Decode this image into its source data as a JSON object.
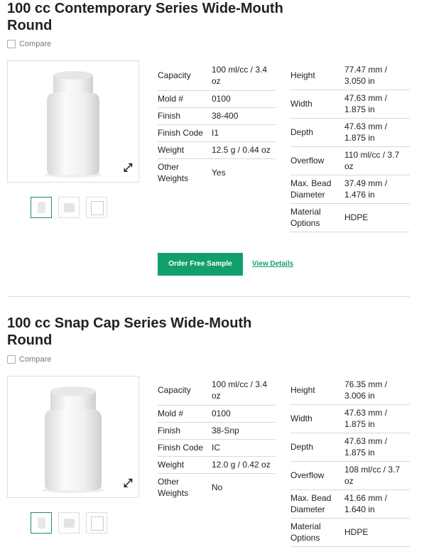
{
  "products": [
    {
      "title": "100 cc Contemporary Series Wide-Mouth Round",
      "compare_label": "Compare",
      "expand_icon": "expand-arrows-icon",
      "left_specs": [
        {
          "label": "Capacity",
          "value": "100 ml/cc / 3.4 oz"
        },
        {
          "label": "Mold #",
          "value": "0100"
        },
        {
          "label": "Finish",
          "value": "38-400"
        },
        {
          "label": "Finish Code",
          "value": "I1"
        },
        {
          "label": "Weight",
          "value": "12.5 g / 0.44 oz"
        },
        {
          "label": "Other Weights",
          "value": "Yes"
        }
      ],
      "right_specs": [
        {
          "label": "Height",
          "value": "77.47 mm / 3.050 in"
        },
        {
          "label": "Width",
          "value": "47.63 mm / 1.875 in"
        },
        {
          "label": "Depth",
          "value": "47.63 mm / 1.875 in"
        },
        {
          "label": "Overflow",
          "value": "110 ml/cc / 3.7 oz"
        },
        {
          "label": "Max. Bead Diameter",
          "value": "37.49 mm / 1.476 in"
        },
        {
          "label": "Material Options",
          "value": "HDPE"
        }
      ],
      "order_label": "Order Free Sample",
      "details_label": "View Details"
    },
    {
      "title": "100 cc Snap Cap Series Wide-Mouth Round",
      "compare_label": "Compare",
      "expand_icon": "expand-arrows-icon",
      "left_specs": [
        {
          "label": "Capacity",
          "value": "100 ml/cc / 3.4 oz"
        },
        {
          "label": "Mold #",
          "value": "0100"
        },
        {
          "label": "Finish",
          "value": "38-Snp"
        },
        {
          "label": "Finish Code",
          "value": "IC"
        },
        {
          "label": "Weight",
          "value": "12.0 g / 0.42 oz"
        },
        {
          "label": "Other Weights",
          "value": "No"
        }
      ],
      "right_specs": [
        {
          "label": "Height",
          "value": "76.35 mm / 3.006 in"
        },
        {
          "label": "Width",
          "value": "47.63 mm / 1.875 in"
        },
        {
          "label": "Depth",
          "value": "47.63 mm / 1.875 in"
        },
        {
          "label": "Overflow",
          "value": "108 ml/cc / 3.7 oz"
        },
        {
          "label": "Max. Bead Diameter",
          "value": "41.66 mm / 1.640 in"
        },
        {
          "label": "Material Options",
          "value": "HDPE"
        }
      ]
    }
  ],
  "colors": {
    "accent": "#12a06a",
    "border": "#dddddd",
    "text": "#222222"
  }
}
